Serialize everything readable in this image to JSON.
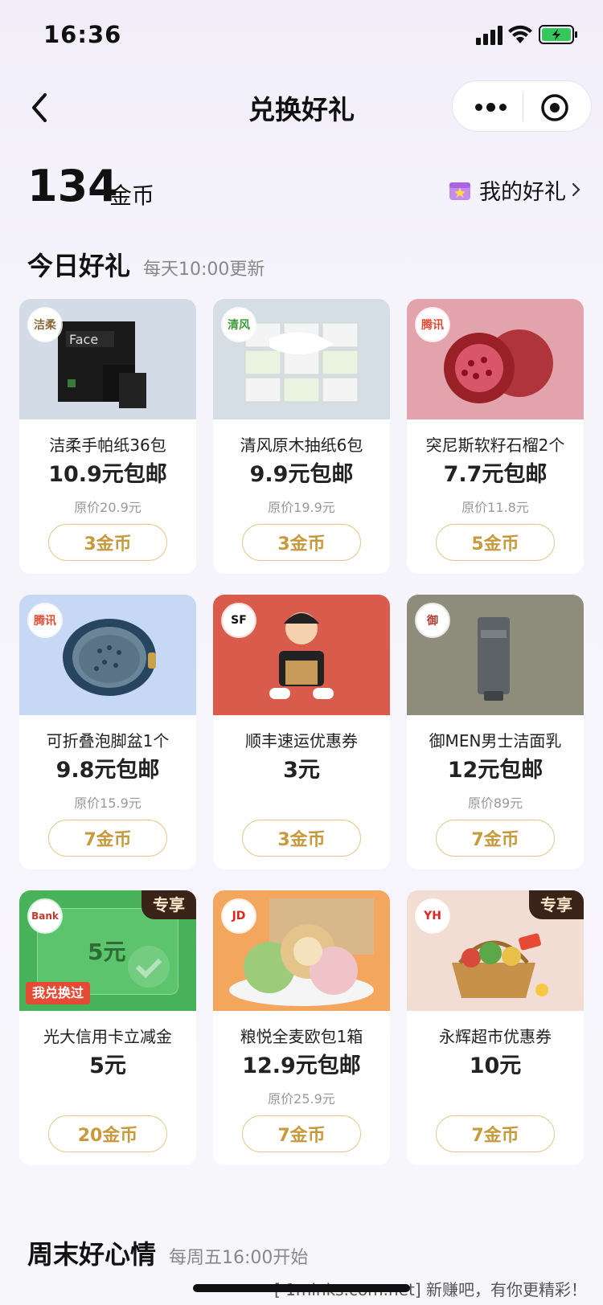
{
  "status_bar": {
    "time": "16:36"
  },
  "nav": {
    "title": "兑换好礼"
  },
  "coins": {
    "value": "134",
    "unit": "金币",
    "my_gifts_label": "我的好礼"
  },
  "today": {
    "title": "今日好礼",
    "subtitle": "每天10:00更新"
  },
  "products": [
    {
      "name": "洁柔手帕纸36包",
      "price": "10.9元包邮",
      "orig": "原价20.9元",
      "coins": "3金币",
      "bg": "#d3dbe6",
      "logo": "洁柔",
      "logo_color": "#8a6a3a"
    },
    {
      "name": "清风原木抽纸6包",
      "price": "9.9元包邮",
      "orig": "原价19.9元",
      "coins": "3金币",
      "bg": "#d5dde5",
      "logo": "清风",
      "logo_color": "#3f9a3a"
    },
    {
      "name": "突尼斯软籽石榴2个",
      "price": "7.7元包邮",
      "orig": "原价11.8元",
      "coins": "5金币",
      "bg": "#e2a3ac",
      "logo": "腾讯",
      "logo_color": "#e64a34"
    },
    {
      "name": "可折叠泡脚盆1个",
      "price": "9.8元包邮",
      "orig": "原价15.9元",
      "coins": "7金币",
      "bg": "#c7d8f4",
      "logo": "腾讯",
      "logo_color": "#e64a34"
    },
    {
      "name": "顺丰速运优惠券",
      "price": "3元",
      "orig": "",
      "coins": "3金币",
      "bg": "#d95b4c",
      "logo": "SF",
      "logo_color": "#111"
    },
    {
      "name": "御MEN男士洁面乳",
      "price": "12元包邮",
      "orig": "原价89元",
      "coins": "7金币",
      "bg": "#8e8d7b",
      "logo": "御",
      "logo_color": "#b03a2e"
    },
    {
      "name": "光大信用卡立减金",
      "price": "5元",
      "orig": "",
      "coins": "20金币",
      "bg": "#48b25a",
      "logo": "Bank",
      "logo_color": "#c0392b",
      "tag": "专享",
      "redeemed": "我兑换过",
      "voucher": "5元"
    },
    {
      "name": "粮悦全麦欧包1箱",
      "price": "12.9元包邮",
      "orig": "原价25.9元",
      "coins": "7金币",
      "bg": "#f2a65e",
      "logo": "JD",
      "logo_color": "#e1251b"
    },
    {
      "name": "永辉超市优惠券",
      "price": "10元",
      "orig": "",
      "coins": "7金币",
      "bg": "#f1ddd3",
      "logo": "YH",
      "logo_color": "#e1251b",
      "tag": "专享"
    }
  ],
  "weekend": {
    "title": "周末好心情",
    "subtitle": "每周五16:00开始"
  },
  "footer": {
    "watermark": "[ 1minks.com.net] 新赚吧，有你更精彩！"
  }
}
